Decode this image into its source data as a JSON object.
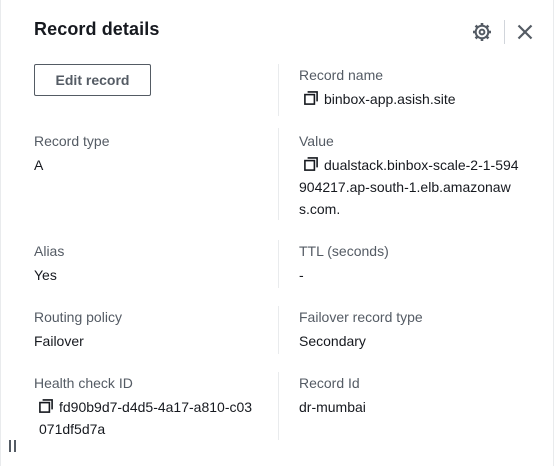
{
  "header": {
    "title": "Record details",
    "settings_icon": "gear-icon",
    "close_icon": "close-icon"
  },
  "actions": {
    "edit_label": "Edit record"
  },
  "fields": {
    "record_name": {
      "label": "Record name",
      "value": "binbox-app.asish.site"
    },
    "record_type": {
      "label": "Record type",
      "value": "A"
    },
    "value": {
      "label": "Value",
      "value": "dualstack.binbox-scale-2-1-594904217.ap-south-1.elb.amazonaws.com."
    },
    "alias": {
      "label": "Alias",
      "value": "Yes"
    },
    "ttl": {
      "label": "TTL (seconds)",
      "value": "-"
    },
    "routing_policy": {
      "label": "Routing policy",
      "value": "Failover"
    },
    "failover_record_type": {
      "label": "Failover record type",
      "value": "Secondary"
    },
    "health_check_id": {
      "label": "Health check ID",
      "value": "fd90b9d7-d4d5-4a17-a810-c03071df5d7a"
    },
    "record_id": {
      "label": "Record Id",
      "value": "dr-mumbai"
    }
  },
  "colors": {
    "text": "#16191f",
    "label": "#545b64",
    "divider": "#e9ebed"
  }
}
